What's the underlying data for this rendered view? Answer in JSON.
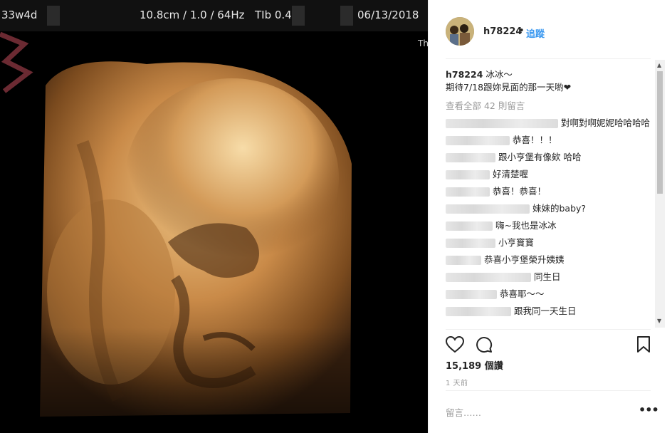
{
  "media": {
    "overlay": {
      "left_text": "33w4d",
      "depth": "10.8cm / 1.0 / 64Hz",
      "tib": "TIb 0.4",
      "date": "06/13/2018",
      "corner_text": "Th"
    }
  },
  "post": {
    "username": "h78224",
    "separator": "•",
    "follow_label": "追蹤",
    "caption_user": "h78224",
    "caption_line1": "冰冰～",
    "caption_line2": "期待7/18跟妳見面的那一天喲❤",
    "view_all_label": "查看全部 42 則留言",
    "comments": [
      {
        "text": "對啊對啊妮妮哈哈哈哈"
      },
      {
        "text": "恭喜！！！"
      },
      {
        "text": "跟小亨堡有像欸 哈哈"
      },
      {
        "text": "好清楚喔"
      },
      {
        "text": "恭喜！恭喜！"
      },
      {
        "text": "妹妹的baby?"
      },
      {
        "text": "嗨~我也是冰冰"
      },
      {
        "text": "小亨寶寶"
      },
      {
        "text": "恭喜小亨堡榮升姨姨"
      },
      {
        "text": "同生日"
      },
      {
        "text": "恭喜耶～～"
      },
      {
        "text": "跟我同一天生日"
      }
    ],
    "likes_label": "15,189 個讚",
    "time_label": "1 天前",
    "add_comment_placeholder": "留言……",
    "more_label": "•••"
  },
  "icons": [
    "heart-icon",
    "comment-icon",
    "bookmark-icon",
    "more-options-icon"
  ]
}
